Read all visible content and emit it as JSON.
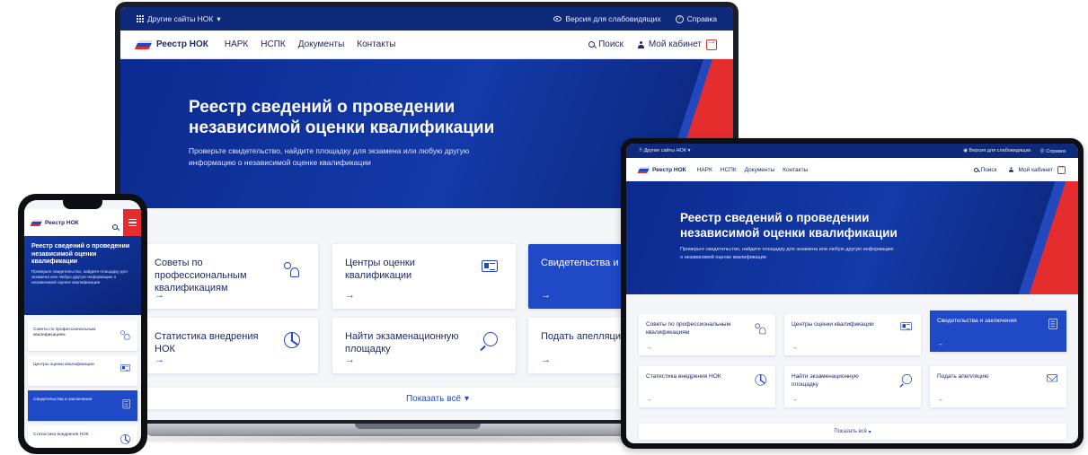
{
  "topbar": {
    "other_sites": "Другие сайты НОК",
    "low_vision": "Версия для слабовидящих",
    "help": "Справка"
  },
  "nav": {
    "logo": "Реестр НОК",
    "links": [
      "НАРК",
      "НСПК",
      "Документы",
      "Контакты"
    ],
    "search": "Поиск",
    "cabinet": "Мой кабинет"
  },
  "hero": {
    "title": "Реестр сведений о проведении независимой оценки квалификации",
    "subtitle": "Проверьте свидетельство, найдите площадку для экзамена или любую другую информацию о независимой оценке квалификации",
    "phone_title": "Реестр сведений о проведении независимой оценки квалификации",
    "phone_subtitle": "Проверьте свидетельство, найдите площадку для экзамена или любую другую информацию о независимой оценке квалификации"
  },
  "cards": [
    {
      "label": "Советы по профессиональным квалификациям",
      "icon": "people-icon",
      "arrow": "→"
    },
    {
      "label": "Центры оценки квалификации",
      "icon": "id-card-icon",
      "arrow": "→"
    },
    {
      "label": "Свидетельства и заключения",
      "icon": "document-icon",
      "arrow": "→"
    },
    {
      "label": "Статистика внедрения НОК",
      "icon": "pie-chart-icon",
      "arrow": "→"
    },
    {
      "label": "Найти экзаменационную площадку",
      "icon": "search-icon",
      "arrow": "→"
    },
    {
      "label": "Подать апелляцию",
      "icon": "mail-icon",
      "arrow": "→"
    }
  ],
  "laptop_cut_labels": {
    "certificates": "Свидетельства и за",
    "appeal": "Подать апелляцию"
  },
  "show_all": "Показать всё",
  "colors": {
    "brand_blue": "#1f49c7",
    "dark_blue": "#0f2a7a",
    "accent_red": "#e52d2d"
  }
}
